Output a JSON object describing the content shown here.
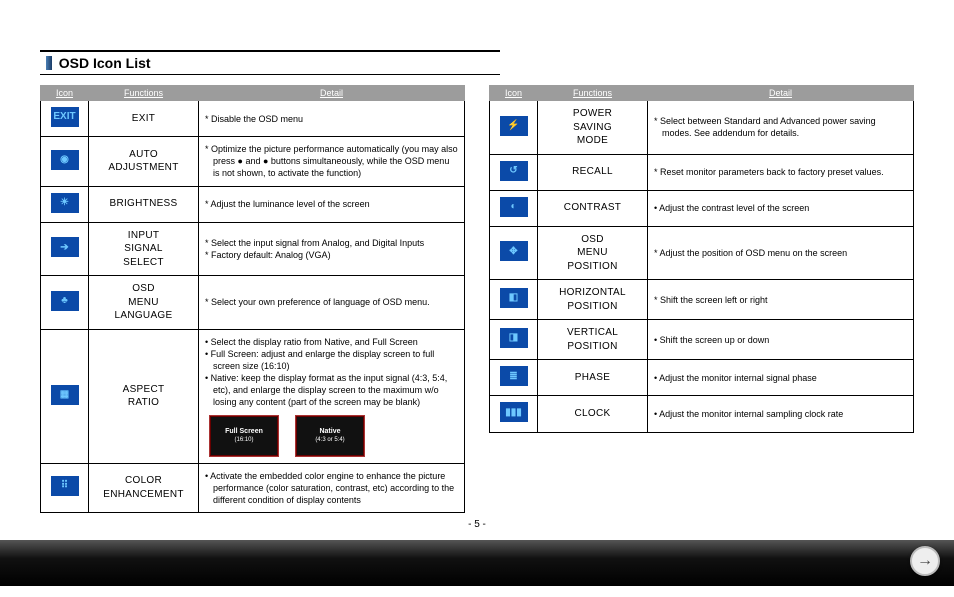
{
  "title": "OSD Icon List",
  "pageNumber": "- 5 -",
  "headers": {
    "icon": "Icon",
    "functions": "Functions",
    "detail": "Detail"
  },
  "arThumbs": {
    "a": {
      "line1": "Full Screen",
      "line2": "(16:10)"
    },
    "b": {
      "line1": "Native",
      "line2": "(4:3 or 5:4)"
    }
  },
  "left": [
    {
      "icon": "EXIT",
      "glyph": "EXIT",
      "func": "EXIT",
      "detail": [
        "* Disable the OSD menu"
      ]
    },
    {
      "icon": "AUTO",
      "glyph": "◉",
      "func": "AUTO ADJUSTMENT",
      "detail": [
        "* Optimize the picture performance automatically (you may also press ● and ● buttons simultaneously, while the OSD menu is not shown, to activate the function)"
      ]
    },
    {
      "icon": "BRIGHT",
      "glyph": "☀",
      "func": "BRIGHTNESS",
      "detail": [
        "* Adjust the luminance level of the screen"
      ]
    },
    {
      "icon": "INPUT",
      "glyph": "➔",
      "func": "INPUT SIGNAL SELECT",
      "detail": [
        "* Select the input signal from Analog, and Digital Inputs",
        "* Factory default: Analog (VGA)"
      ]
    },
    {
      "icon": "LANG",
      "glyph": "♣",
      "func": "OSD MENU LANGUAGE",
      "detail": [
        "* Select your own preference of language of OSD menu."
      ]
    },
    {
      "icon": "ASPECT",
      "glyph": "▦",
      "func": "ASPECT RATIO",
      "detail": [
        "• Select the display ratio from Native, and Full Screen",
        "• Full Screen: adjust and enlarge the display screen to full screen size (16:10)",
        "• Native: keep the display format as the input signal (4:3, 5:4, etc), and enlarge the display screen to the maximum w/o losing any content (part of the screen may be blank)"
      ],
      "hasThumbs": true
    },
    {
      "icon": "COLOR",
      "glyph": "⠿",
      "func": "COLOR ENHANCEMENT",
      "detail": [
        "• Activate the embedded color engine to enhance the picture performance (color saturation, contrast, etc) according to the different condition of display contents"
      ]
    }
  ],
  "right": [
    {
      "icon": "POWER",
      "glyph": "⚡",
      "func": "POWER SAVING MODE",
      "detail": [
        "* Select between Standard and Advanced power saving modes. See addendum for details."
      ]
    },
    {
      "icon": "RECALL",
      "glyph": "↺",
      "func": "RECALL",
      "detail": [
        "* Reset monitor parameters back to factory preset values."
      ]
    },
    {
      "icon": "CONTRAST",
      "glyph": "◐",
      "func": "CONTRAST",
      "detail": [
        "• Adjust the contrast level of the screen"
      ]
    },
    {
      "icon": "OSDPOS",
      "glyph": "✥",
      "func": "OSD MENU POSITION",
      "detail": [
        "* Adjust the position of OSD menu on the screen"
      ]
    },
    {
      "icon": "HPOS",
      "glyph": "◧",
      "func": "HORIZONTAL POSITION",
      "detail": [
        "* Shift the screen left or right"
      ]
    },
    {
      "icon": "VPOS",
      "glyph": "◨",
      "func": "VERTICAL POSITION",
      "detail": [
        "• Shift the screen up or down"
      ]
    },
    {
      "icon": "PHASE",
      "glyph": "≣",
      "func": "PHASE",
      "detail": [
        "• Adjust the monitor internal signal phase"
      ]
    },
    {
      "icon": "CLOCK",
      "glyph": "▮▮▮",
      "func": "CLOCK",
      "detail": [
        "• Adjust the monitor internal sampling clock rate"
      ]
    }
  ]
}
